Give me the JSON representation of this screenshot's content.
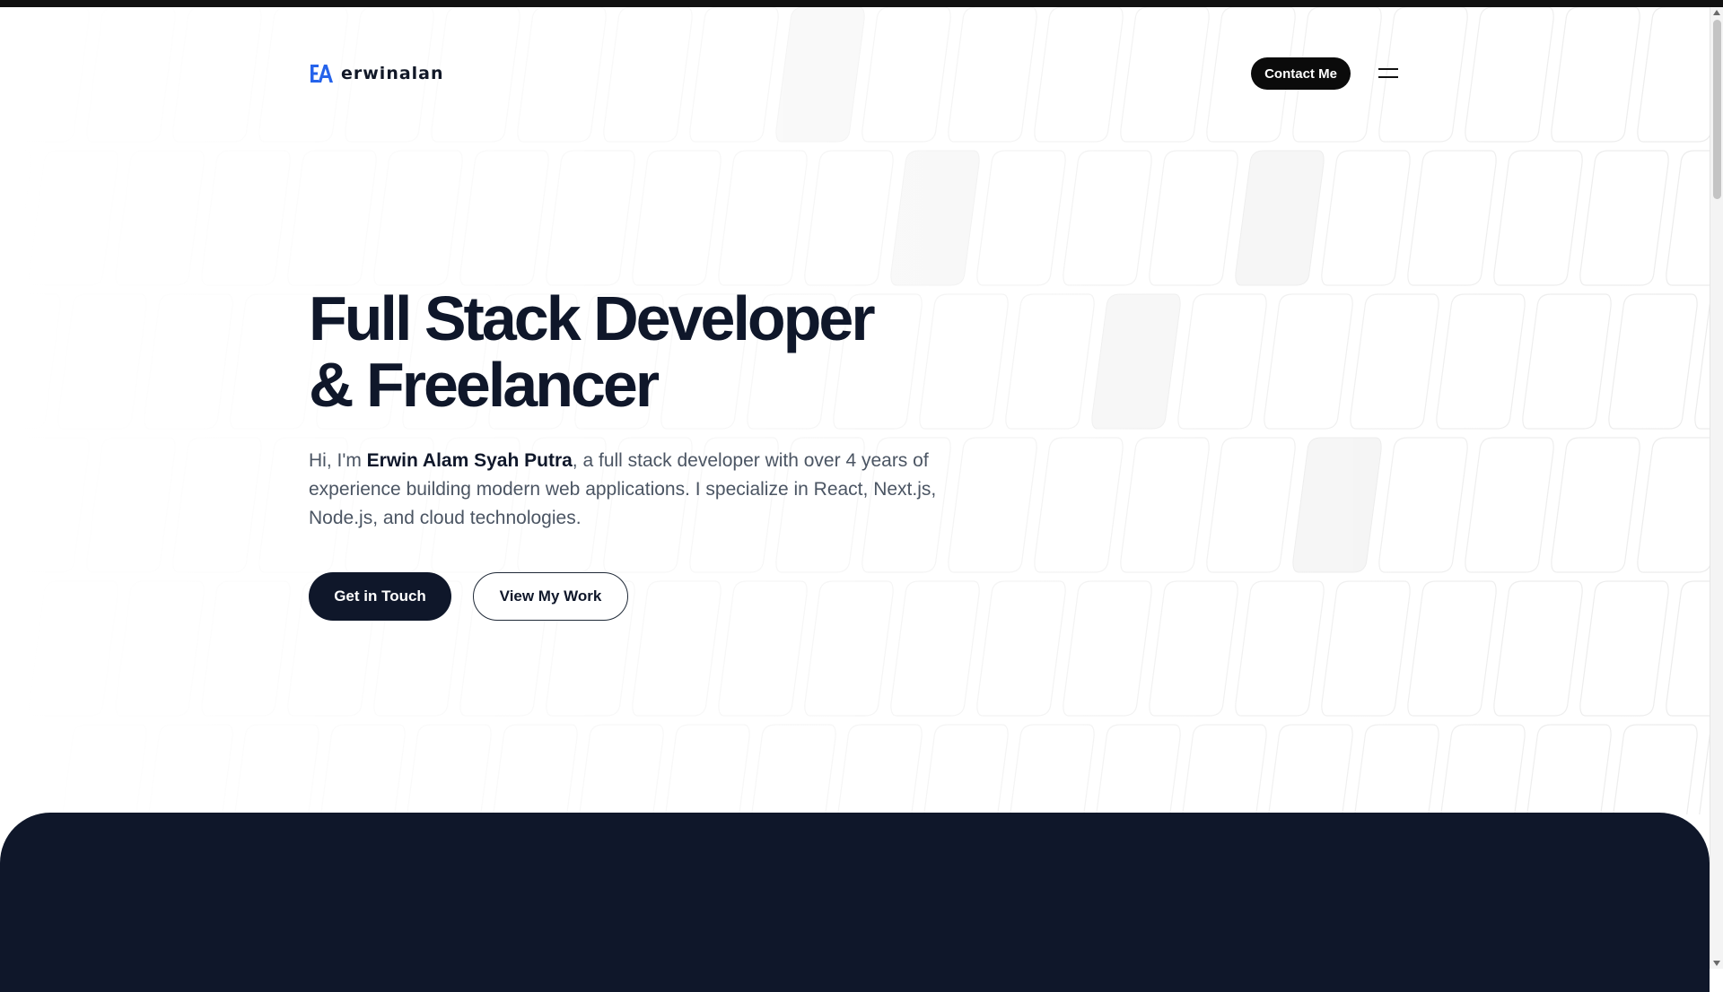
{
  "brand": {
    "name": "erwinalan",
    "logo_icon": "ea-monogram-icon",
    "accent_color": "#2563eb"
  },
  "header": {
    "contact_label": "Contact Me",
    "menu_icon": "hamburger-menu-icon"
  },
  "hero": {
    "title_line1": "Full Stack Developer",
    "title_line2": "& Freelancer",
    "intro_prefix": "Hi, I'm ",
    "intro_name": "Erwin Alam Syah Putra",
    "intro_suffix": ", a full stack developer with over 4 years of experience building modern web applications. I specialize in React, Next.js, Node.js, and cloud technologies.",
    "primary_cta": "Get in Touch",
    "secondary_cta": "View My Work"
  },
  "colors": {
    "primary_dark": "#0f172a",
    "text_muted": "#4b5563",
    "background": "#ffffff"
  }
}
